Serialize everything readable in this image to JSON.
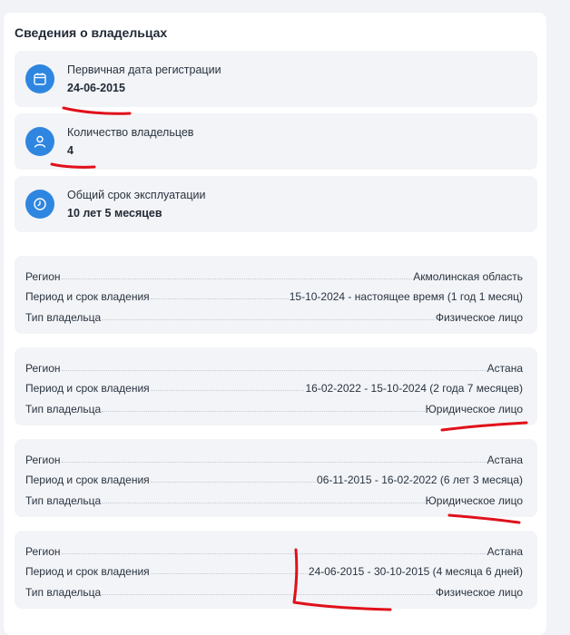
{
  "panel": {
    "title": "Сведения о владельцах"
  },
  "summary": {
    "registration": {
      "label": "Первичная дата регистрации",
      "value": "24-06-2015",
      "icon": "calendar-icon"
    },
    "owners_count": {
      "label": "Количество владельцев",
      "value": "4",
      "icon": "user-icon"
    },
    "usage_period": {
      "label": "Общий срок эксплуатации",
      "value": "10 лет 5 месяцев",
      "icon": "clock-icon"
    }
  },
  "owners": [
    {
      "region_label": "Регион",
      "region": "Акмолинская область",
      "period_label": "Период и срок владения",
      "period": "15-10-2024 - настоящее время (1 год 1 месяц)",
      "type_label": "Тип владельца",
      "type": "Физическое лицо"
    },
    {
      "region_label": "Регион",
      "region": "Астана",
      "period_label": "Период и срок владения",
      "period": "16-02-2022 - 15-10-2024 (2 года 7 месяцев)",
      "type_label": "Тип владельца",
      "type": "Юридическое лицо"
    },
    {
      "region_label": "Регион",
      "region": "Астана",
      "period_label": "Период и срок владения",
      "period": "06-11-2015 - 16-02-2022 (6 лет 3 месяца)",
      "type_label": "Тип владельца",
      "type": "Юридическое лицо"
    },
    {
      "region_label": "Регион",
      "region": "Астана",
      "period_label": "Период и срок владения",
      "period": "24-06-2015 - 30-10-2015 (4 месяца 6 дней)",
      "type_label": "Тип владельца",
      "type": "Физическое лицо"
    }
  ],
  "colors": {
    "accent": "#2f86e0",
    "card_bg": "#f2f4f7",
    "annotation": "#e0101a"
  }
}
